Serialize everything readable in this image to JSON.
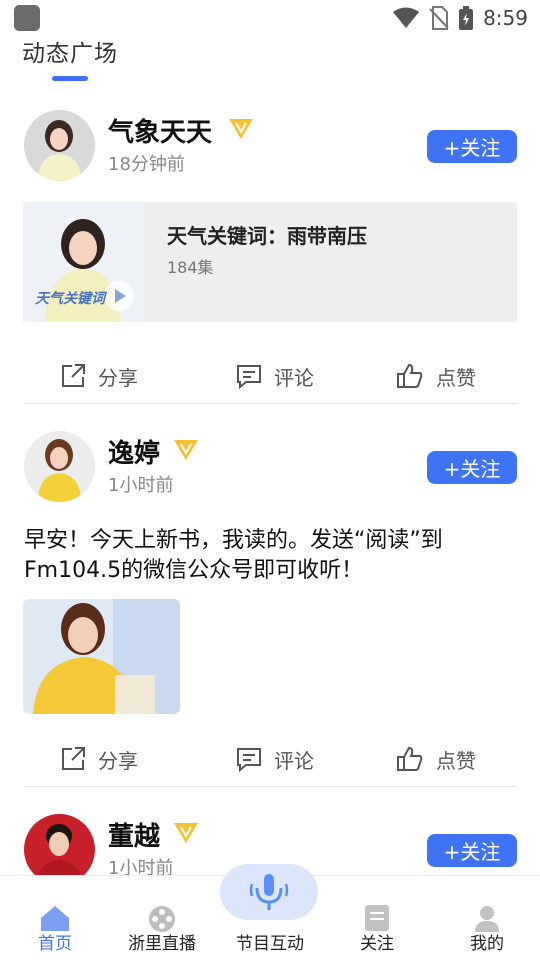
{
  "status_bar": {
    "time": "8:59"
  },
  "top_tab": {
    "label": "动态广场"
  },
  "posts": [
    {
      "author": "气象天天",
      "time": "18分钟前",
      "follow_label": "+关注",
      "program": {
        "title": "天气关键词：雨带南压",
        "count": "184集",
        "thumb_caption": "天气关键词"
      },
      "actions": {
        "share": "分享",
        "comment": "评论",
        "like": "点赞"
      }
    },
    {
      "author": "逸婷",
      "time": "1小时前",
      "follow_label": "+关注",
      "text_line1": "早安！今天上新书，我读的。发送“阅读”到",
      "text_line2": "Fm104.5的微信公众号即可收听！",
      "actions": {
        "share": "分享",
        "comment": "评论",
        "like": "点赞"
      }
    },
    {
      "author": "董越",
      "time": "1小时前",
      "follow_label": "+关注"
    }
  ],
  "bottom_nav": {
    "items": [
      {
        "label": "首页"
      },
      {
        "label": "浙里直播"
      },
      {
        "label": "节目互动"
      },
      {
        "label": "关注"
      },
      {
        "label": "我的"
      }
    ]
  },
  "colors": {
    "accent": "#3f73f4",
    "badge": "#f3c234"
  }
}
